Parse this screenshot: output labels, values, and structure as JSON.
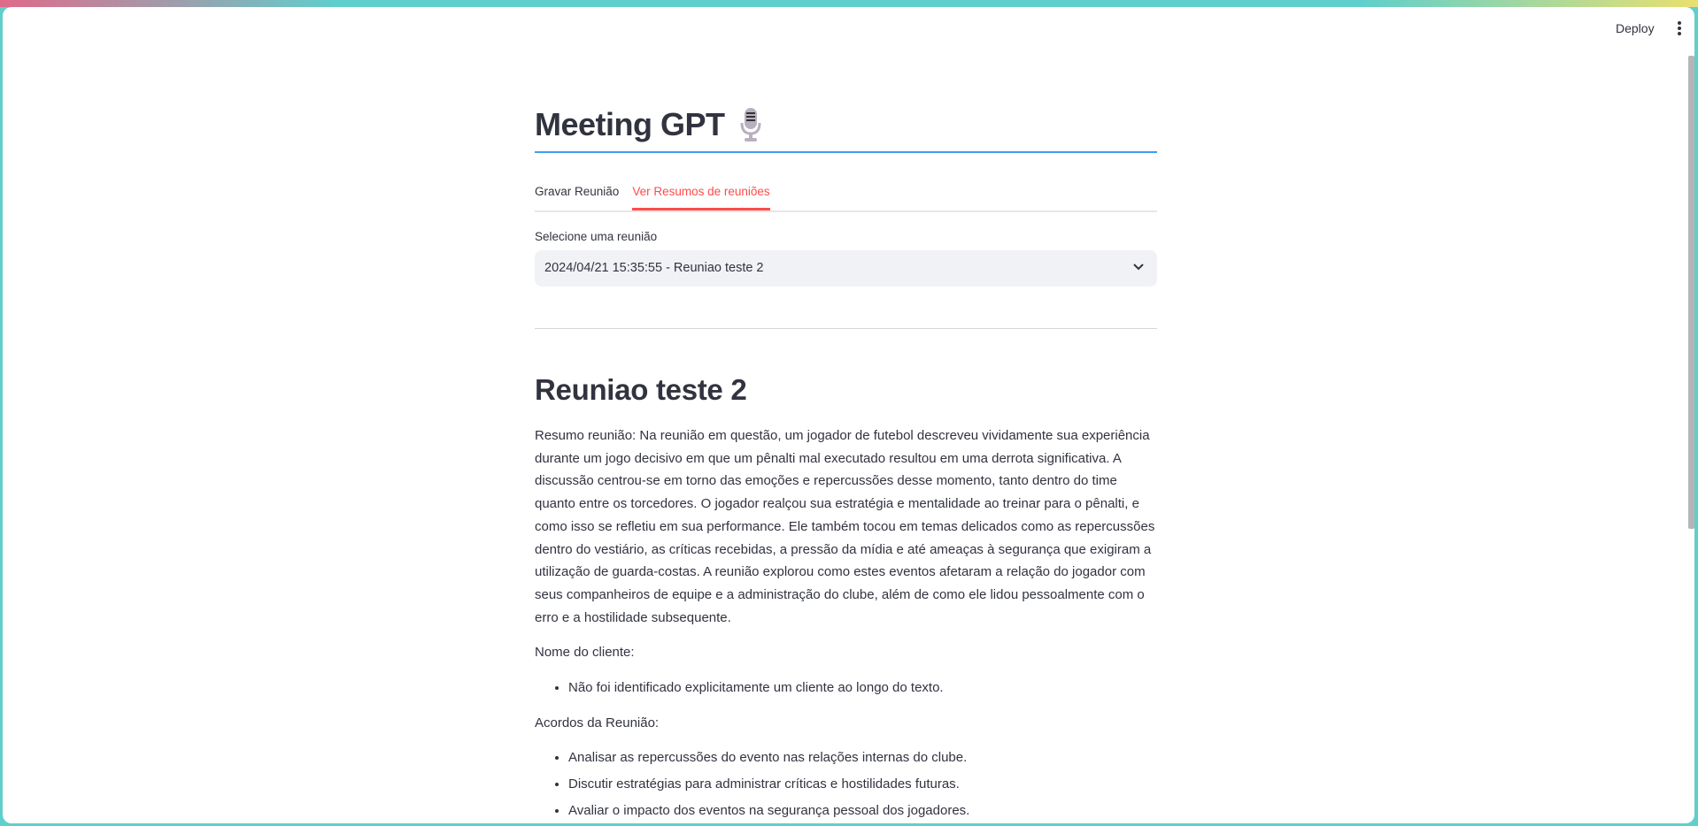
{
  "header": {
    "deploy_label": "Deploy",
    "menu_icon": "kebab-menu-icon"
  },
  "page": {
    "title": "Meeting GPT",
    "title_icon": "studio-microphone-icon",
    "accent": "#3d9df3"
  },
  "tabs": [
    {
      "label": "Gravar Reunião",
      "active": false
    },
    {
      "label": "Ver Resumos de reuniões",
      "active": true
    }
  ],
  "tab_active_color": "#ff4b4b",
  "select": {
    "label": "Selecione uma reunião",
    "value": "2024/04/21 15:35:55 - Reuniao teste 2"
  },
  "meeting": {
    "title": "Reuniao teste 2",
    "summary": "Resumo reunião: Na reunião em questão, um jogador de futebol descreveu vividamente sua experiência durante um jogo decisivo em que um pênalti mal executado resultou em uma derrota significativa. A discussão centrou-se em torno das emoções e repercussões desse momento, tanto dentro do time quanto entre os torcedores. O jogador realçou sua estratégia e mentalidade ao treinar para o pênalti, e como isso se refletiu em sua performance. Ele também tocou em temas delicados como as repercussões dentro do vestiário, as críticas recebidas, a pressão da mídia e até ameaças à segurança que exigiram a utilização de guarda-costas. A reunião explorou como estes eventos afetaram a relação do jogador com seus companheiros de equipe e a administração do clube, além de como ele lidou pessoalmente com o erro e a hostilidade subsequente.",
    "client_label": "Nome do cliente:",
    "client_items": [
      "Não foi identificado explicitamente um cliente ao longo do texto."
    ],
    "agreements_label": "Acordos da Reunião:",
    "agreements": [
      "Analisar as repercussões do evento nas relações internas do clube.",
      "Discutir estratégias para administrar críticas e hostilidades futuras.",
      "Avaliar o impacto dos eventos na segurança pessoal dos jogadores."
    ]
  }
}
